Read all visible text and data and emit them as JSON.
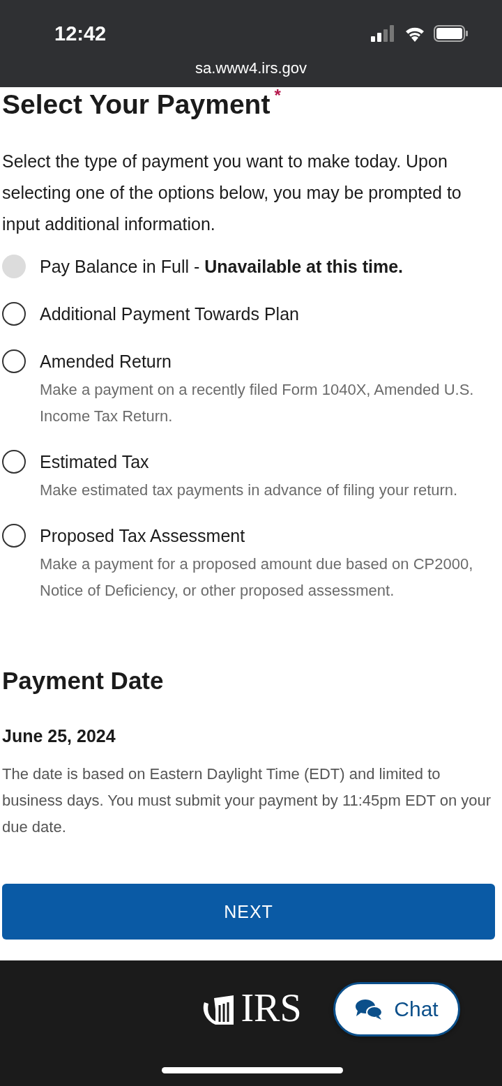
{
  "status_bar": {
    "time": "12:42"
  },
  "browser": {
    "url": "sa.www4.irs.gov"
  },
  "payment": {
    "title": "Select Your Payment",
    "required_mark": "*",
    "intro": "Select the type of payment you want to make today. Upon selecting one of the options below, you may be prompted to input additional information.",
    "options": [
      {
        "label": "Pay Balance in Full - **Unavailable at this time.**",
        "selected": false,
        "disabled": true
      },
      {
        "label": "Additional Payment Towards Plan",
        "selected": false,
        "disabled": false
      },
      {
        "label": "Amended Return",
        "description": "Make a payment on a recently filed Form 1040X, Amended U.S. Income Tax Return.",
        "selected": false,
        "disabled": false
      },
      {
        "label": "Estimated Tax",
        "description": "Make estimated tax payments in advance of filing your return.",
        "selected": false,
        "disabled": false
      },
      {
        "label": "Proposed Tax Assessment",
        "description": "Make a payment for a proposed amount due based on CP2000, Notice of Deficiency, or other proposed assessment.",
        "selected": false,
        "disabled": false
      }
    ]
  },
  "payment_date": {
    "title": "Payment Date",
    "date": "June 25, 2024",
    "note": "The date is based on Eastern Daylight Time (EDT) and limited to business days. You must submit your payment by 11:45pm EDT on your due date."
  },
  "next_button": "NEXT",
  "chat_button": "Chat",
  "footer": {
    "logo": "IRS"
  }
}
